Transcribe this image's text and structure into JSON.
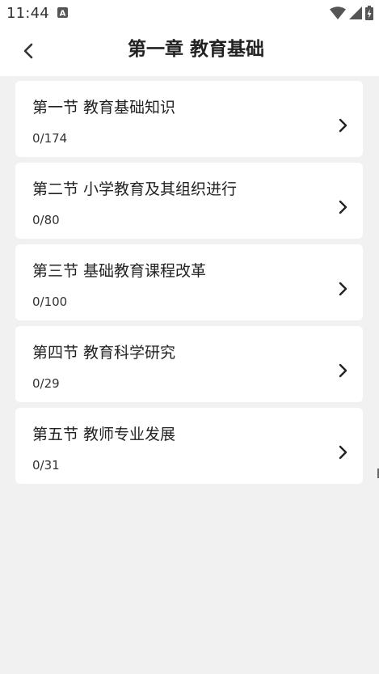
{
  "status_bar": {
    "time": "11:44",
    "icons": [
      "notification-a-icon",
      "wifi-icon",
      "signal-icon",
      "battery-icon"
    ]
  },
  "header": {
    "title": "第一章 教育基础",
    "back_icon": "chevron-left-icon"
  },
  "sections": [
    {
      "title": "第一节 教育基础知识",
      "progress": "0/174"
    },
    {
      "title": "第二节 小学教育及其组织进行",
      "progress": "0/80"
    },
    {
      "title": "第三节 基础教育课程改革",
      "progress": "0/100"
    },
    {
      "title": "第四节 教育科学研究",
      "progress": "0/29"
    },
    {
      "title": "第五节 教师专业发展",
      "progress": "0/31"
    }
  ],
  "colors": {
    "background": "#f1f1f1",
    "card": "#ffffff",
    "text": "#222222"
  }
}
